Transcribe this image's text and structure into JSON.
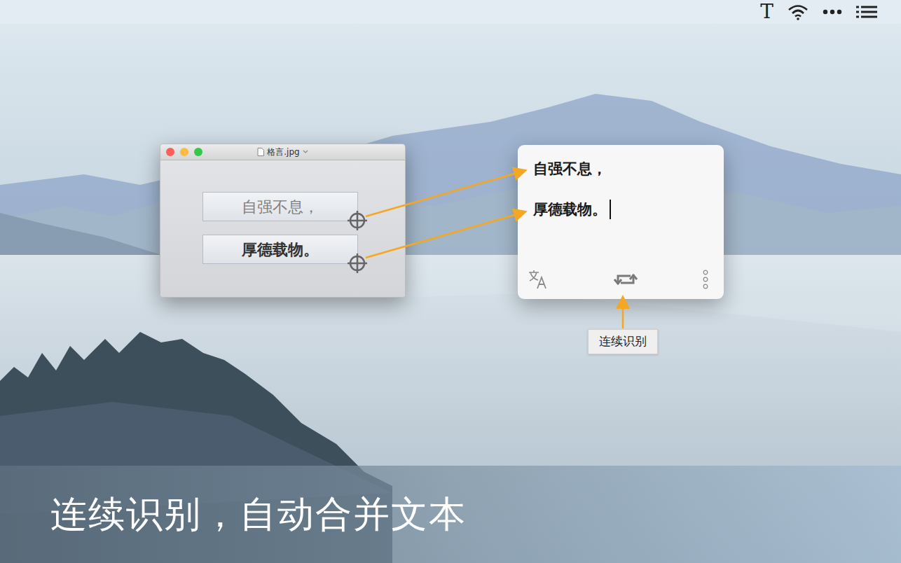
{
  "menu_bar": {
    "app_glyph": "T"
  },
  "image_window": {
    "title": "格言.jpg",
    "lines": [
      {
        "text": "自强不息，",
        "dimmed": true
      },
      {
        "text": "厚德载物。",
        "dimmed": false
      }
    ]
  },
  "result_popup": {
    "lines": [
      "自强不息，",
      "厚德载物。"
    ],
    "caret_after_last_line": true,
    "tooltip": "连续识别"
  },
  "caption": "连续识别，自动合并文本"
}
